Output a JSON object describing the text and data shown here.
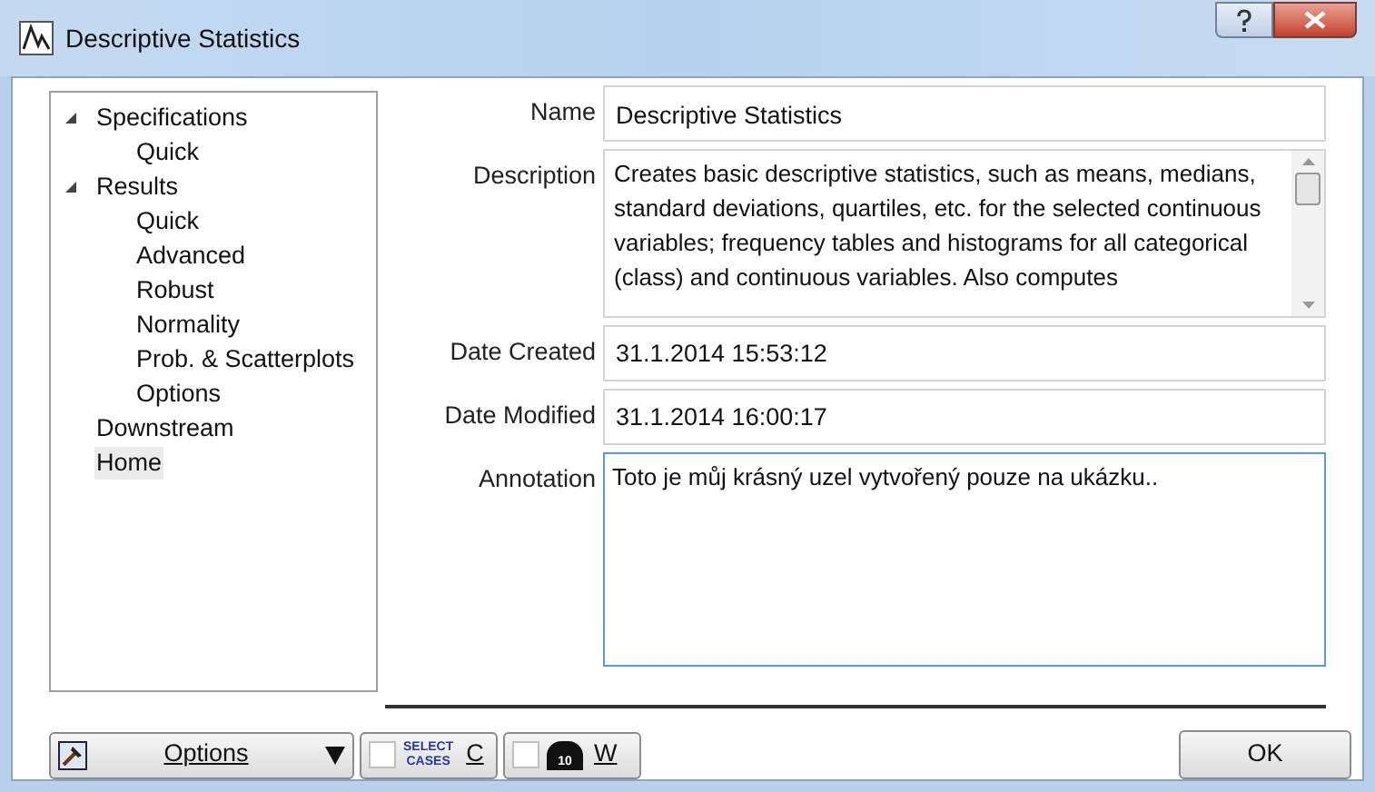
{
  "window": {
    "title": "Descriptive Statistics"
  },
  "tree": [
    {
      "label": "Specifications",
      "expanded": true,
      "selected": false,
      "children": [
        {
          "label": "Quick",
          "selected": false
        }
      ]
    },
    {
      "label": "Results",
      "expanded": true,
      "selected": false,
      "children": [
        {
          "label": "Quick",
          "selected": false
        },
        {
          "label": "Advanced",
          "selected": false
        },
        {
          "label": "Robust",
          "selected": false
        },
        {
          "label": "Normality",
          "selected": false
        },
        {
          "label": "Prob. & Scatterplots",
          "selected": false
        },
        {
          "label": "Options",
          "selected": false
        }
      ]
    },
    {
      "label": "Downstream",
      "selected": false
    },
    {
      "label": "Home",
      "selected": true
    }
  ],
  "form": {
    "name_label": "Name",
    "name": "Descriptive Statistics",
    "description_label": "Description",
    "description": "Creates basic descriptive statistics, such as means, medians, standard deviations, quartiles, etc. for the selected continuous variables; frequency tables and histograms for all categorical (class) and continuous variables. Also computes",
    "date_created_label": "Date Created",
    "date_created": "31.1.2014 15:53:12",
    "date_modified_label": "Date Modified",
    "date_modified": "31.1.2014 16:00:17",
    "annotation_label": "Annotation",
    "annotation": "Toto je můj krásný uzel vytvořený pouze na ukázku.."
  },
  "buttons": {
    "options": "Options",
    "select_cases_icon": [
      "SELECT",
      "CASES"
    ],
    "select_cases": "C",
    "select_cases_checked": false,
    "weight_icon": "10",
    "weight": "W",
    "weight_checked": false,
    "ok": "OK"
  }
}
